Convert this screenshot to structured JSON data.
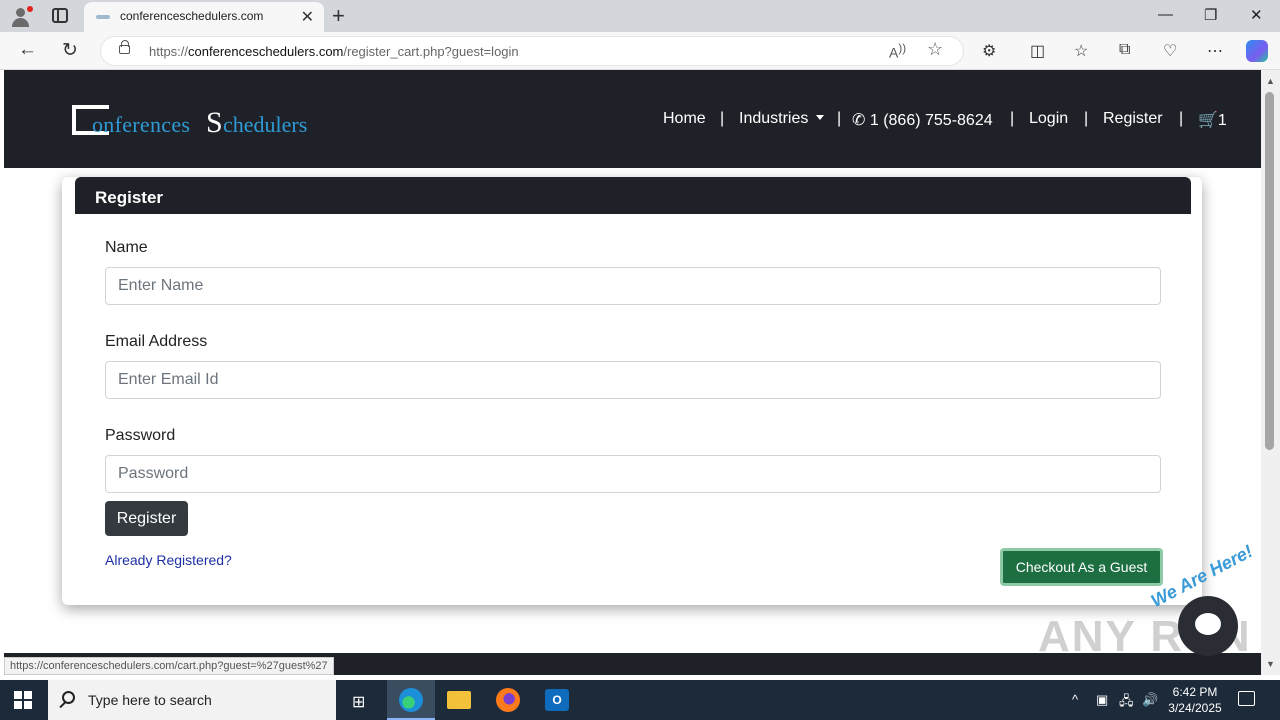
{
  "browser": {
    "tab_title": "conferenceschedulers.com",
    "url_prefix": "https://",
    "url_domain": "conferenceschedulers.com",
    "url_path": "/register_cart.php?guest=login",
    "status_url": "https://conferenceschedulers.com/cart.php?guest=%27guest%27"
  },
  "site": {
    "logo_c_text": "onferences",
    "logo_s_letter": "S",
    "logo_s_rest": "chedulers",
    "nav": {
      "home": "Home",
      "industries": "Industries",
      "phone": "1 (866) 755-8624",
      "login": "Login",
      "register": "Register",
      "cart_count": "1"
    }
  },
  "form": {
    "heading": "Register",
    "name_label": "Name",
    "name_placeholder": "Enter Name",
    "email_label": "Email Address",
    "email_placeholder": "Enter Email Id",
    "password_label": "Password",
    "password_placeholder": "Password",
    "register_button": "Register",
    "already_registered_link": "Already Registered?",
    "guest_button": "Checkout As a Guest"
  },
  "watermark": {
    "text": "ANY RUN",
    "badge": "We Are Here!"
  },
  "taskbar": {
    "search_placeholder": "Type here to search",
    "time": "6:42 PM",
    "date": "3/24/2025"
  },
  "colors": {
    "header_bg": "#1e2228",
    "logo_blue": "#2f9bd6",
    "guest_button": "#1d6f42",
    "link": "#1f2fa6"
  }
}
